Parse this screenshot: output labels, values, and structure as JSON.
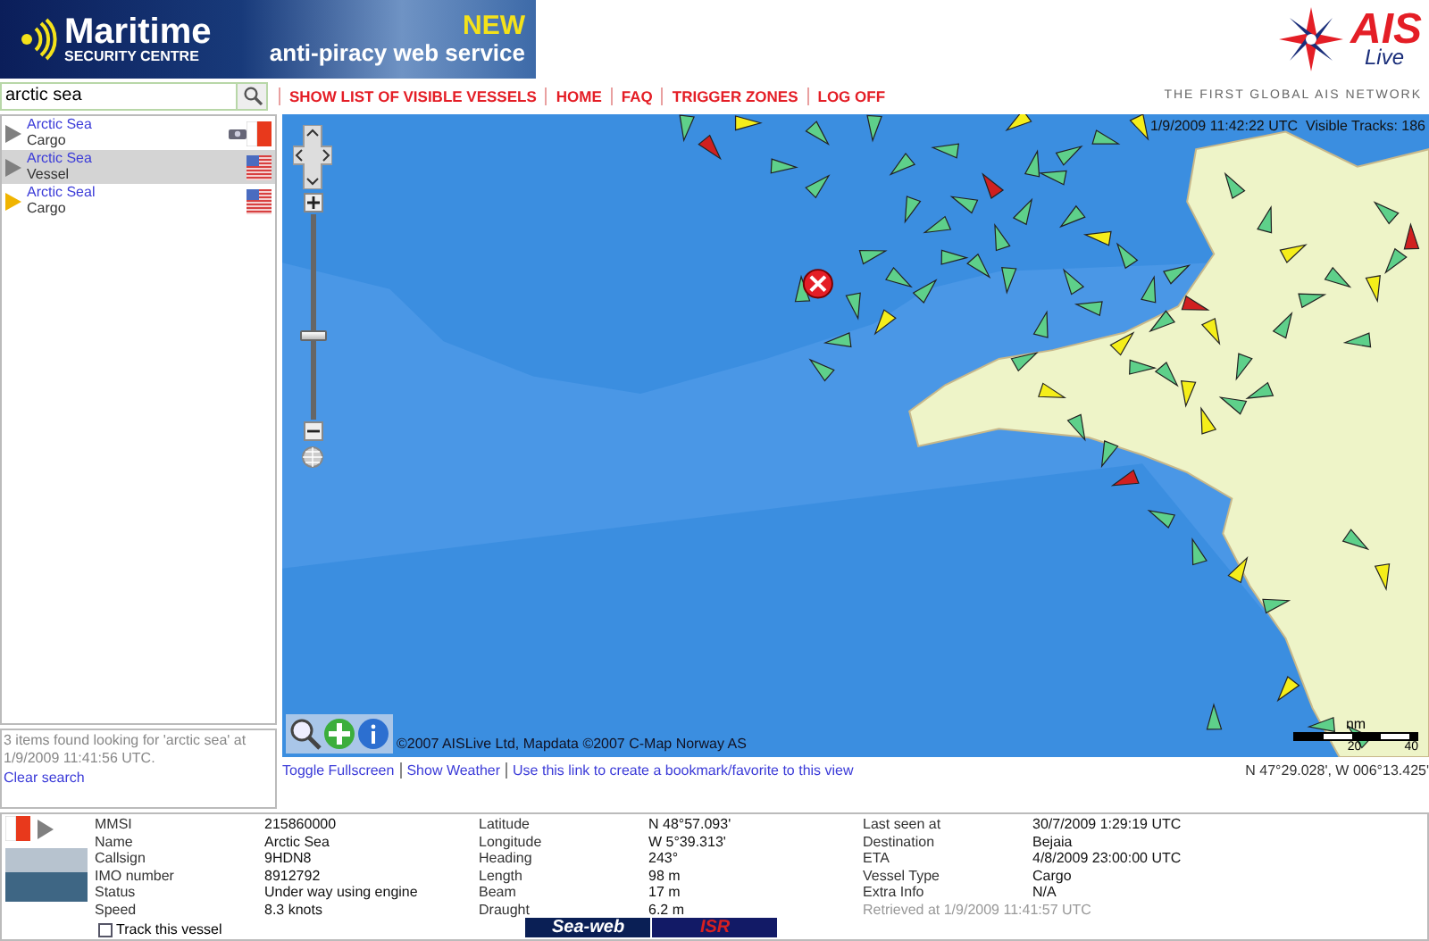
{
  "banner": {
    "brand": "Maritime",
    "brand_sub": "SECURITY CENTRE",
    "badge": "NEW",
    "tagline": "anti-piracy web service"
  },
  "logo": {
    "title": "AIS",
    "subtitle": "Live",
    "slogan": "THE FIRST GLOBAL AIS NETWORK"
  },
  "search": {
    "value": "arctic sea"
  },
  "nav": [
    "SHOW LIST OF VISIBLE VESSELS",
    "HOME",
    "FAQ",
    "TRIGGER ZONES",
    "LOG OFF"
  ],
  "results": [
    {
      "name": "Arctic Sea",
      "type": "Cargo",
      "selected": false,
      "color": "#808080",
      "kind": "mt",
      "photo": true
    },
    {
      "name": "Arctic Sea",
      "type": "Vessel",
      "selected": true,
      "color": "#808080",
      "kind": "us",
      "photo": false
    },
    {
      "name": "Arctic Seal",
      "type": "Cargo",
      "selected": false,
      "color": "#f0b400",
      "kind": "us",
      "photo": false
    }
  ],
  "search_status": {
    "message": "3 items found looking for 'arctic sea' at 1/9/2009 11:41:56 UTC.",
    "clear": "Clear search"
  },
  "map": {
    "timestamp": "1/9/2009 11:42:22 UTC",
    "tracks": "Visible Tracks: 186",
    "zoom": {
      "level": 0.4
    },
    "copyright": "©2007 AISLive Ltd, Mapdata ©2007 C-Map Norway AS",
    "scale": {
      "unit": "nm",
      "ticks": [
        "20",
        "40"
      ]
    }
  },
  "map_links": [
    "Toggle Fullscreen",
    "Show Weather",
    "Use this link to create a bookmark/favorite to this view"
  ],
  "coordinates": "N 47°29.028', W 006°13.425'",
  "details": {
    "columns": [
      [
        {
          "label": "MMSI",
          "value": "215860000"
        },
        {
          "label": "Name",
          "value": "Arctic Sea"
        },
        {
          "label": "Callsign",
          "value": "9HDN8"
        },
        {
          "label": "IMO number",
          "value": "8912792"
        },
        {
          "label": "Status",
          "value": "Under way using engine"
        },
        {
          "label": "Speed",
          "value": "8.3 knots"
        }
      ],
      [
        {
          "label": "Latitude",
          "value": "N 48°57.093'"
        },
        {
          "label": "Longitude",
          "value": "W 5°39.313'"
        },
        {
          "label": "Heading",
          "value": "243°"
        },
        {
          "label": "Length",
          "value": "98 m"
        },
        {
          "label": "Beam",
          "value": "17 m"
        },
        {
          "label": "Draught",
          "value": "6.2 m"
        }
      ],
      [
        {
          "label": "Last seen at",
          "value": "30/7/2009 1:29:19 UTC"
        },
        {
          "label": "Destination",
          "value": "Bejaia"
        },
        {
          "label": "ETA",
          "value": "4/8/2009 23:00:00 UTC"
        },
        {
          "label": "Vessel Type",
          "value": "Cargo"
        },
        {
          "label": "Extra Info",
          "value": "N/A"
        }
      ]
    ],
    "retrieved": "Retrieved at 1/9/2009 11:41:57 UTC",
    "track": {
      "label": "Track this vessel",
      "checked": false
    },
    "partners": [
      "Sea-web",
      "ISR"
    ]
  }
}
